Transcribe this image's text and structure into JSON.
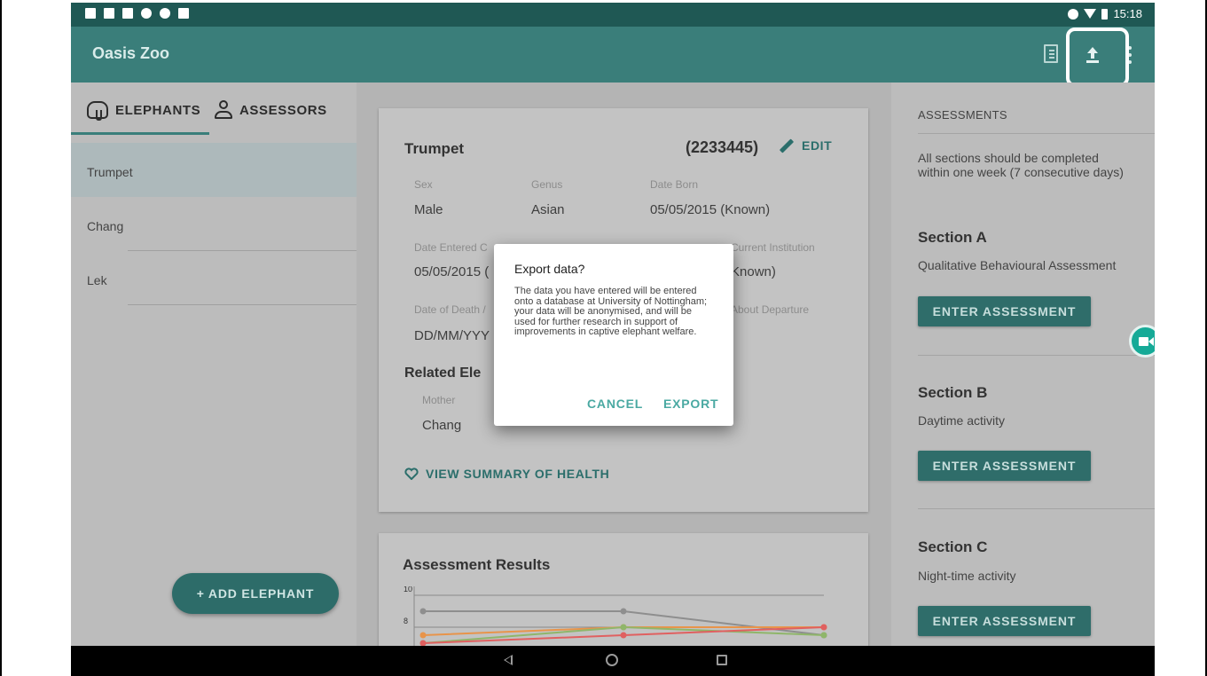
{
  "status_bar": {
    "time": "15:18"
  },
  "app_bar": {
    "title": "Oasis Zoo",
    "icons": [
      "notes-icon",
      "upload-icon",
      "more-vert-icon"
    ]
  },
  "tabs": [
    {
      "label": "ELEPHANTS",
      "icon": "elephant-icon",
      "selected": true
    },
    {
      "label": "ASSESSORS",
      "icon": "person-icon",
      "selected": false
    }
  ],
  "elephants": [
    {
      "name": "Trumpet",
      "selected": true
    },
    {
      "name": "Chang",
      "selected": false
    },
    {
      "name": "Lek",
      "selected": false
    }
  ],
  "add_elephant_label": "+ ADD ELEPHANT",
  "detail": {
    "name": "Trumpet",
    "id": "(2233445)",
    "edit_label": "EDIT",
    "sex_label": "Sex",
    "sex_value": "Male",
    "genus_label": "Genus",
    "genus_value": "Asian",
    "born_label": "Date Born",
    "born_value": "05/05/2015 (Known)",
    "entered_label": "Date Entered C",
    "entered_value": "05/05/2015 (",
    "current_inst_label": "Current Institution",
    "current_inst_value": "Known)",
    "death_label": "Date of Death /",
    "death_value": "DD/MM/YYY",
    "departure_label": "About Departure",
    "related_title": "Related Ele",
    "mother_label": "Mother",
    "mother_value": "Chang",
    "view_summary_label": "VIEW SUMMARY OF HEALTH"
  },
  "results": {
    "title": "Assessment Results",
    "y_ticks": [
      "10",
      "8"
    ]
  },
  "chart_data": {
    "type": "line",
    "title": "Assessment Results",
    "ylim": [
      6,
      10
    ],
    "y_ticks": [
      10,
      8
    ],
    "x": [
      0,
      1,
      2
    ],
    "series": [
      {
        "color": "#8e8e8e",
        "values": [
          9,
          9,
          7.5
        ]
      },
      {
        "color": "#e8944a",
        "values": [
          7.5,
          8,
          8
        ]
      },
      {
        "color": "#8fb66a",
        "values": [
          7,
          8,
          7.5
        ]
      },
      {
        "color": "#e06060",
        "values": [
          7,
          7.5,
          8
        ]
      }
    ]
  },
  "assessments": {
    "header": "ASSESSMENTS",
    "note": "All sections should be completed within one week (7 consecutive days)",
    "sections": [
      {
        "title": "Section A",
        "subtitle": "Qualitative Behavioural Assessment",
        "button": "ENTER ASSESSMENT"
      },
      {
        "title": "Section B",
        "subtitle": "Daytime activity",
        "button": "ENTER ASSESSMENT"
      },
      {
        "title": "Section C",
        "subtitle": "Night-time activity",
        "button": "ENTER ASSESSMENT"
      }
    ]
  },
  "dialog": {
    "title": "Export data?",
    "body": "The data you have entered will be entered onto a database at University of Nottingham; your data will be anonymised, and will be used for further research in support of improvements in captive elephant welfare.",
    "cancel": "CANCEL",
    "confirm": "EXPORT"
  }
}
